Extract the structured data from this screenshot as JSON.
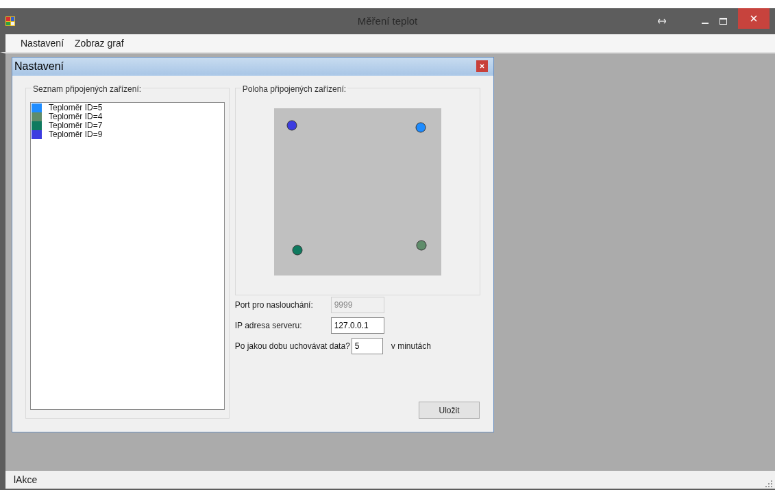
{
  "window": {
    "title": "Měření teplot"
  },
  "menu": [
    "Nastavení",
    "Zobraz graf"
  ],
  "dialog": {
    "title": "Nastavení",
    "devices_group": {
      "title": "Seznam připojených zařízení:",
      "items": [
        {
          "label": "Teploměr ID=5",
          "color": "#1e8cff"
        },
        {
          "label": "Teploměr ID=4",
          "color": "#5f8c6a"
        },
        {
          "label": "Teploměr ID=7",
          "color": "#0f7a5f"
        },
        {
          "label": "Teploměr ID=9",
          "color": "#3c3ce0"
        }
      ]
    },
    "map_group": {
      "title": "Poloha připojených zařízení:",
      "markers": [
        {
          "color": "#1e8cff"
        },
        {
          "color": "#5f8c6a"
        },
        {
          "color": "#0f7a5f"
        },
        {
          "color": "#3c3ce0"
        }
      ]
    },
    "fields": [
      {
        "label": "Port pro naslouchání:",
        "value": "9999",
        "disabled": true
      },
      {
        "label": "IP adresa serveru:",
        "value": "127.0.0.1",
        "disabled": false
      },
      {
        "label": "Po jakou dobu uchovávat data?",
        "value": "5",
        "disabled": false,
        "suffix": "v minutách"
      }
    ],
    "save_button": "Uložit"
  },
  "status_bar": "lAkce"
}
